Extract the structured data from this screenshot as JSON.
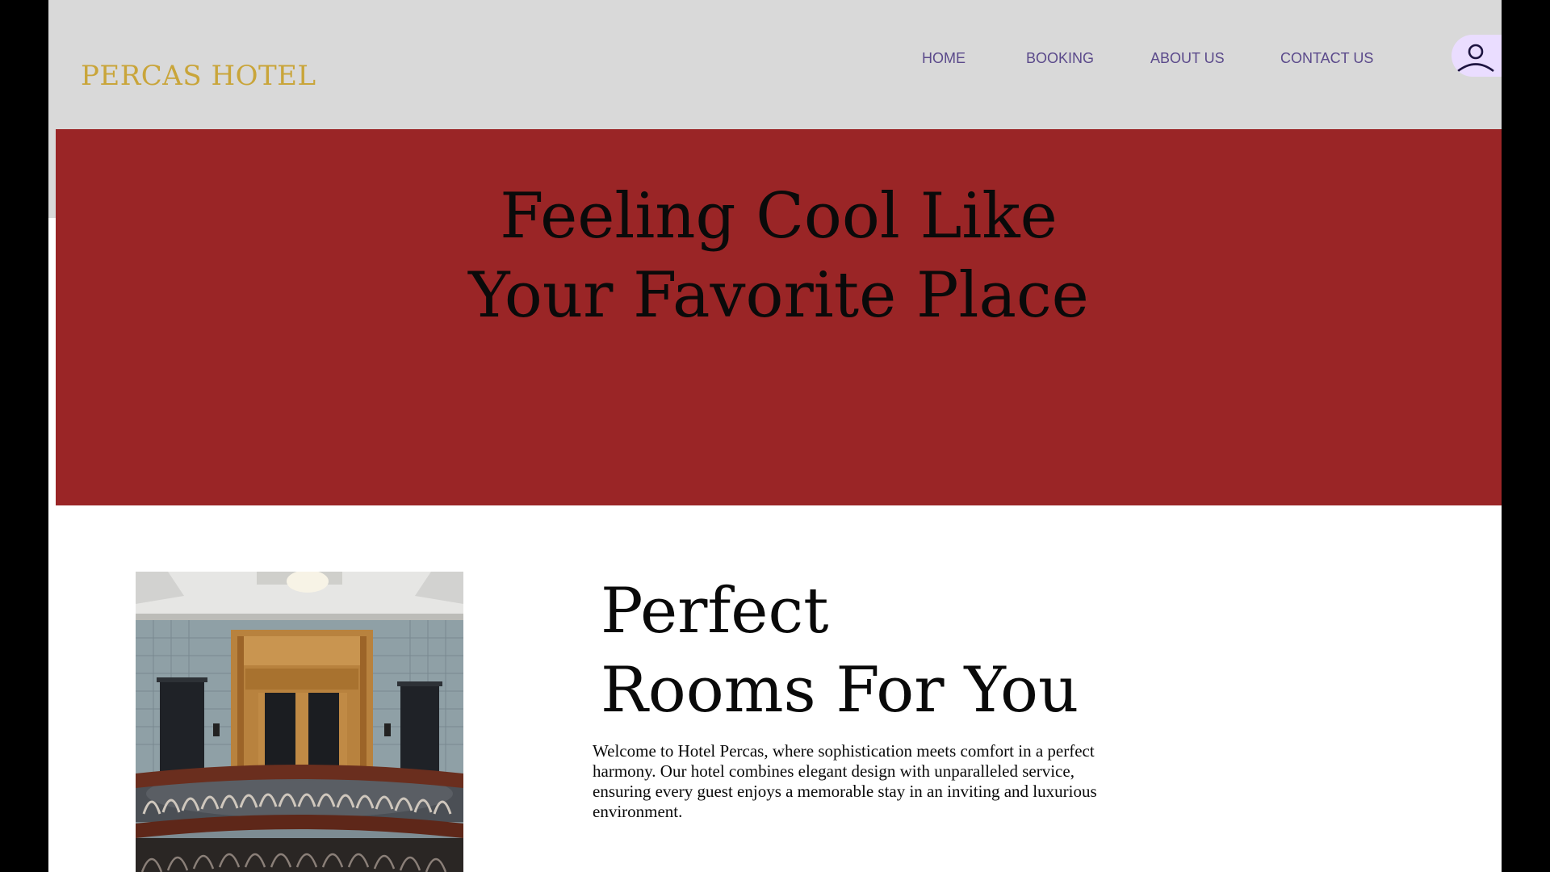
{
  "brand": {
    "name": "PERCAS HOTEL",
    "color": "#c9a53a"
  },
  "nav": {
    "items": [
      {
        "label": "HOME"
      },
      {
        "label": "BOOKING"
      },
      {
        "label": "ABOUT US"
      },
      {
        "label": "CONTACT US"
      }
    ],
    "link_color": "#5b4a8b"
  },
  "user": {
    "icon": "user-icon",
    "background": "#eaddff"
  },
  "hero": {
    "title_line1": "Feeling Cool Like",
    "title_line2": "Your Favorite Place",
    "background": "#9a2526"
  },
  "rooms": {
    "title_line1": "Perfect",
    "title_line2": "Rooms For You",
    "description": "Welcome to Hotel Percas, where sophistication meets comfort in a perfect harmony. Our hotel combines elegant design with unparalleled service, ensuring every guest enjoys a memorable stay in an inviting and luxurious environment.",
    "image": "hotel-lobby-elevators-photo"
  }
}
